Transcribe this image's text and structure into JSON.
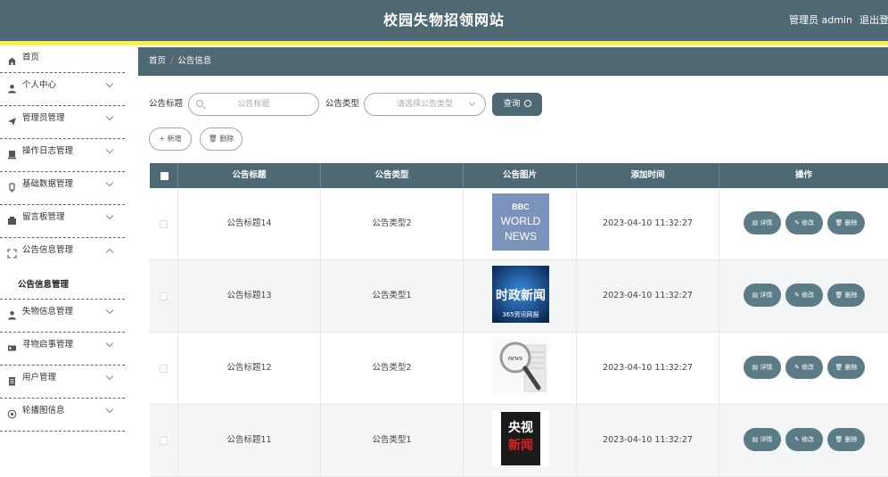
{
  "header": {
    "title": "校园失物招领网站",
    "user": "管理员 admin",
    "logout": "退出登"
  },
  "sidebar": {
    "items": [
      {
        "label": "首页",
        "icon": "home-icon"
      },
      {
        "label": "个人中心",
        "icon": "user-icon"
      },
      {
        "label": "管理员管理",
        "icon": "send-icon"
      },
      {
        "label": "操作日志管理",
        "icon": "log-icon"
      },
      {
        "label": "基础数据管理",
        "icon": "data-icon"
      },
      {
        "label": "留言板管理",
        "icon": "message-icon"
      },
      {
        "label": "公告信息管理",
        "icon": "expand-icon"
      },
      {
        "label": "失物信息管理",
        "icon": "user-icon"
      },
      {
        "label": "寻物启事管理",
        "icon": "ticket-icon"
      },
      {
        "label": "用户管理",
        "icon": "doc-icon"
      },
      {
        "label": "轮播图信息",
        "icon": "carousel-icon"
      }
    ],
    "sub_item": "公告信息管理"
  },
  "breadcrumb": {
    "home": "首页",
    "separator": "/",
    "current": "公告信息"
  },
  "search": {
    "title_label": "公告标题",
    "title_placeholder": "公告标题",
    "type_label": "公告类型",
    "type_placeholder": "请选择公告类型",
    "query_button": "查询"
  },
  "actions": {
    "add_button": "+ 新增",
    "delete_button": "🗑 删除"
  },
  "table": {
    "headers": [
      "公告标题",
      "公告类型",
      "公告图片",
      "添加时间",
      "操作"
    ],
    "rows": [
      {
        "title": "公告标题14",
        "type": "公告类型2",
        "image": "BBC WORLD NEWS",
        "time": "2023-04-10 11:32:27"
      },
      {
        "title": "公告标题13",
        "type": "公告类型1",
        "image": "时政新闻",
        "time": "2023-04-10 11:32:27"
      },
      {
        "title": "公告标题12",
        "type": "公告类型2",
        "image": "news",
        "time": "2023-04-10 11:32:27"
      },
      {
        "title": "公告标题11",
        "type": "公告类型1",
        "image": "央视新闻",
        "time": "2023-04-10 11:32:27"
      }
    ],
    "op_labels": {
      "detail": "详情",
      "edit": "修改",
      "delete": "删除"
    }
  },
  "image_text": {
    "bbc": "BBC",
    "world": "WORLD",
    "news": "NEWS",
    "shizheng": "时政新闻",
    "shizheng_sub": "365资讯网报",
    "news_lower": "news",
    "cctv": "央视",
    "cctv2": "新闻"
  },
  "colors": {
    "primary": "#4e6973",
    "accent_line": "#f5f04c",
    "op_button": "#5b7c87"
  }
}
